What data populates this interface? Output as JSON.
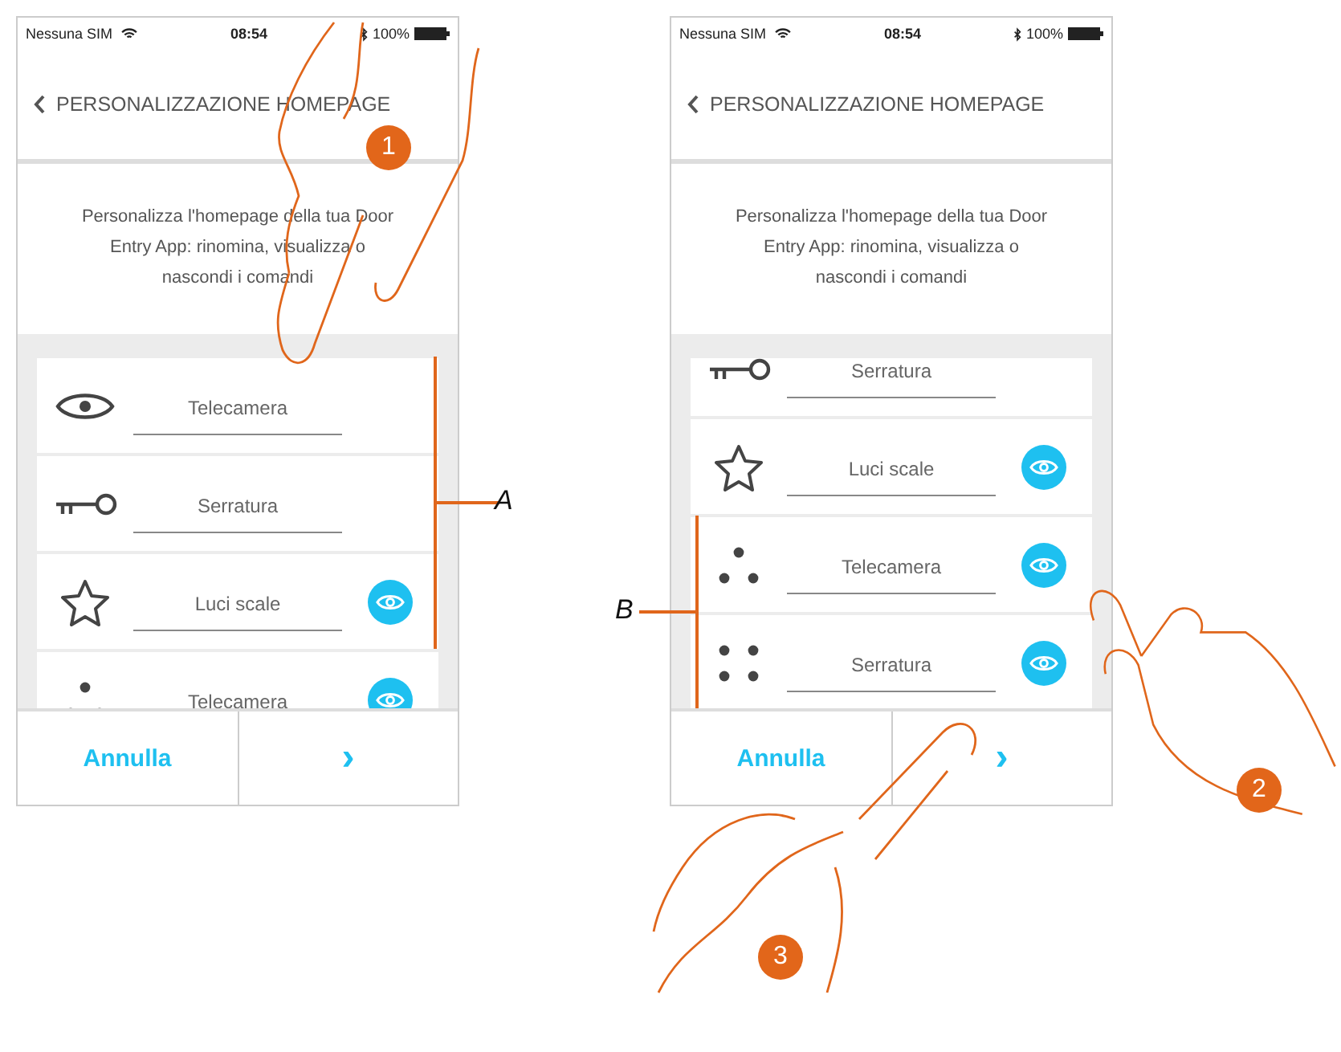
{
  "screens": [
    {
      "status_bar": {
        "carrier": "Nessuna SIM",
        "time": "08:54",
        "battery": "100%"
      },
      "header": {
        "title": "PERSONALIZZAZIONE HOMEPAGE"
      },
      "description": "Personalizza l'homepage della tua Door Entry App: rinomina, visualizza o nascondi i comandi",
      "items": [
        {
          "kind": "eye",
          "label": "Telecamera",
          "visible": false
        },
        {
          "kind": "key",
          "label": "Serratura",
          "visible": false
        },
        {
          "kind": "star",
          "label": "Luci scale",
          "visible": true
        },
        {
          "kind": "dots3",
          "label": "Telecamera",
          "visible": true
        }
      ],
      "buttons": {
        "cancel": "Annulla",
        "next": "›"
      }
    },
    {
      "status_bar": {
        "carrier": "Nessuna SIM",
        "time": "08:54",
        "battery": "100%"
      },
      "header": {
        "title": "PERSONALIZZAZIONE HOMEPAGE"
      },
      "description": "Personalizza l'homepage della tua Door Entry App: rinomina, visualizza o nascondi i comandi",
      "items": [
        {
          "kind": "key",
          "label": "Serratura",
          "visible": false
        },
        {
          "kind": "star",
          "label": "Luci scale",
          "visible": true
        },
        {
          "kind": "dots3",
          "label": "Telecamera",
          "visible": true
        },
        {
          "kind": "dots4",
          "label": "Serratura",
          "visible": true
        }
      ],
      "buttons": {
        "cancel": "Annulla",
        "next": "›"
      }
    }
  ],
  "callouts": [
    {
      "label": "A"
    },
    {
      "label": "B"
    }
  ],
  "steps": [
    "1",
    "2",
    "3"
  ]
}
